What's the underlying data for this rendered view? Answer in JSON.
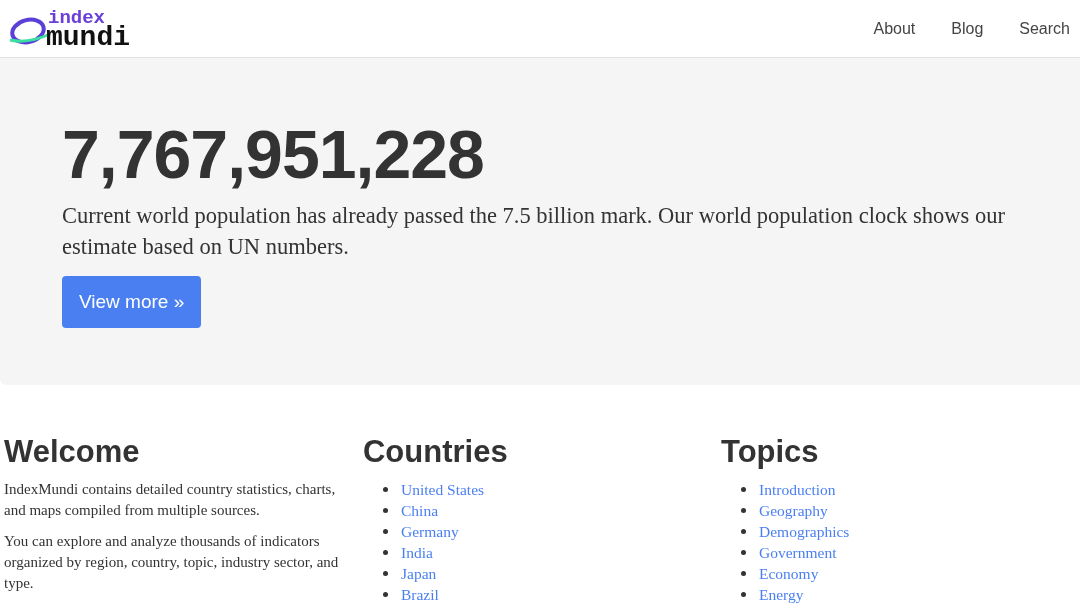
{
  "header": {
    "logo": {
      "top": "index",
      "bottom": "mundi"
    },
    "nav": [
      "About",
      "Blog",
      "Search"
    ]
  },
  "hero": {
    "number": "7,767,951,228",
    "text": "Current world population has already passed the 7.5 billion mark. Our world population clock shows our estimate based on UN numbers.",
    "button": "View more »"
  },
  "welcome": {
    "title": "Welcome",
    "paragraphs": [
      "IndexMundi contains detailed country statistics, charts, and maps compiled from multiple sources.",
      "You can explore and analyze thousands of indicators organized by region, country, topic, industry sector, and type."
    ]
  },
  "countries": {
    "title": "Countries",
    "links": [
      "United States",
      "China",
      "Germany",
      "India",
      "Japan",
      "Brazil"
    ]
  },
  "topics": {
    "title": "Topics",
    "links": [
      "Introduction",
      "Geography",
      "Demographics",
      "Government",
      "Economy",
      "Energy"
    ]
  }
}
